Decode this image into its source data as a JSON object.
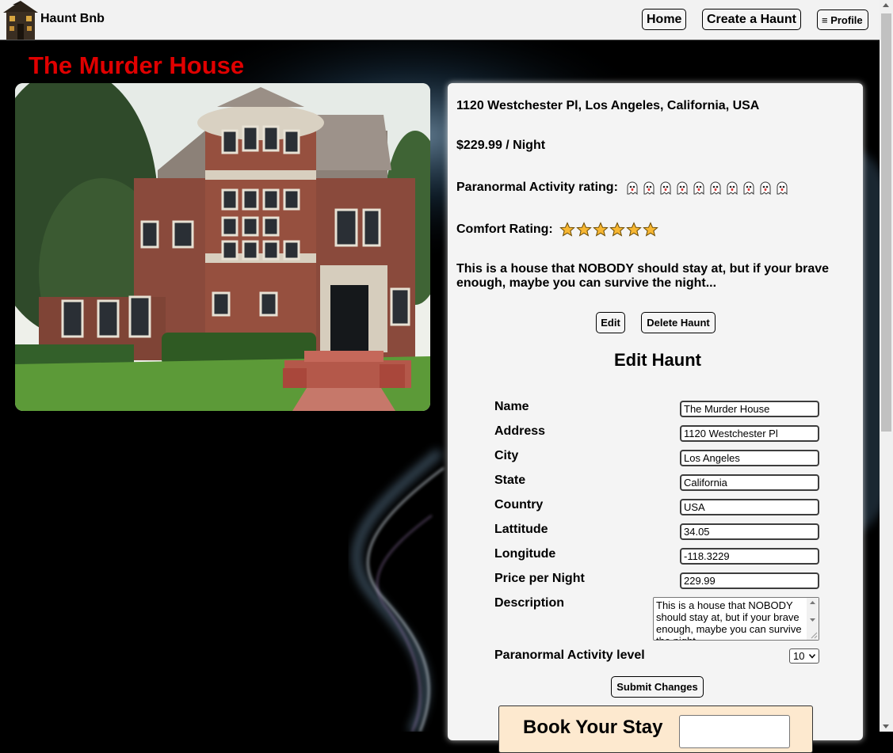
{
  "navbar": {
    "brand": "Haunt Bnb",
    "home_label": "Home",
    "create_label": "Create a Haunt",
    "profile_label": "≡ Profile"
  },
  "listing": {
    "title": "The Murder House",
    "address": "1120 Westchester Pl, Los Angeles, California, USA",
    "price": "$229.99 / Night",
    "paranormal_label": "Paranormal Activity rating:",
    "paranormal_rating": 10,
    "comfort_label": "Comfort Rating:",
    "comfort_rating": 6,
    "description": "This is a house that NOBODY should stay at, but if your brave enough, maybe you can survive the night...",
    "edit_label": "Edit",
    "delete_label": "Delete Haunt"
  },
  "edit_form": {
    "heading": "Edit Haunt",
    "fields": [
      {
        "label": "Name",
        "value": "The Murder House"
      },
      {
        "label": "Address",
        "value": "1120 Westchester Pl"
      },
      {
        "label": "City",
        "value": "Los Angeles"
      },
      {
        "label": "State",
        "value": "California"
      },
      {
        "label": "Country",
        "value": "USA"
      },
      {
        "label": "Lattitude",
        "value": "34.05"
      },
      {
        "label": "Longitude",
        "value": "-118.3229"
      },
      {
        "label": "Price per Night",
        "value": "229.99"
      }
    ],
    "description_label": "Description",
    "description_value": "This is a house that NOBODY should stay at, but if your brave enough, maybe you can survive the night...",
    "paranormal_label": "Paranormal Activity level",
    "paranormal_value": "10",
    "submit_label": "Submit Changes"
  },
  "booking": {
    "title": "Book Your Stay"
  },
  "colors": {
    "title": "#e00000",
    "panel": "#f4f4f4",
    "booking_bg": "#fde9cf"
  }
}
